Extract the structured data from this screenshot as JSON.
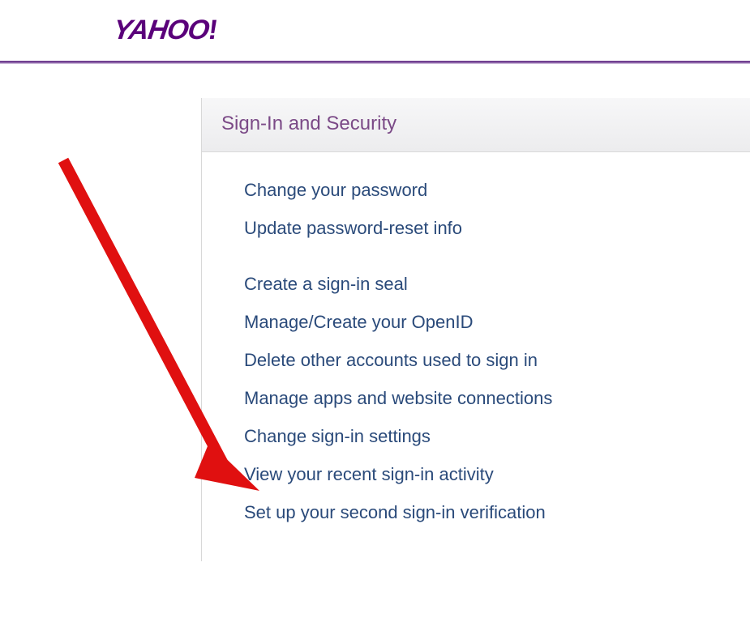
{
  "header": {
    "logo_text": "YAHOO",
    "logo_exclaim": "!"
  },
  "panel": {
    "title": "Sign-In and Security",
    "groups": [
      [
        {
          "id": "change-password",
          "label": "Change your password"
        },
        {
          "id": "update-reset-info",
          "label": "Update password-reset info"
        }
      ],
      [
        {
          "id": "create-signin-seal",
          "label": "Create a sign-in seal"
        },
        {
          "id": "manage-openid",
          "label": "Manage/Create your OpenID"
        },
        {
          "id": "delete-other-accounts",
          "label": "Delete other accounts used to sign in"
        },
        {
          "id": "manage-apps",
          "label": "Manage apps and website connections"
        },
        {
          "id": "change-signin-settings",
          "label": "Change sign-in settings"
        },
        {
          "id": "view-recent-activity",
          "label": "View your recent sign-in activity"
        },
        {
          "id": "setup-second-verification",
          "label": "Set up your second sign-in verification"
        }
      ]
    ]
  },
  "annotation": {
    "arrow_color": "#e01010"
  }
}
